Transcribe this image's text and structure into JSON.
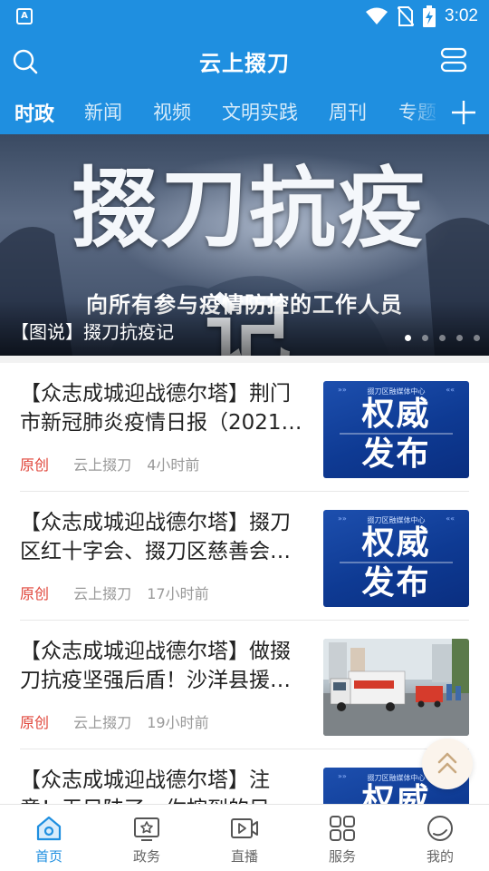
{
  "status_bar": {
    "time": "3:02",
    "app_icon_letter": "A"
  },
  "header": {
    "title": "云上掇刀",
    "search_icon": "search-icon",
    "menu_icon": "menu-icon"
  },
  "tabs": [
    {
      "label": "时政",
      "active": true
    },
    {
      "label": "新闻"
    },
    {
      "label": "视频"
    },
    {
      "label": "文明实践"
    },
    {
      "label": "周刊"
    },
    {
      "label": "专题"
    }
  ],
  "banner": {
    "headline": "掇刀抗疫记",
    "subtitle": "向所有参与疫情防控的工作人员",
    "caption": "【图说】掇刀抗疫记",
    "slide_count": 5,
    "active_slide": 0
  },
  "news": [
    {
      "title": "【众志成城迎战德尔塔】荆门市新冠肺炎疫情日报（2021…",
      "tag": "原创",
      "source": "云上掇刀",
      "time": "4小时前",
      "thumb": {
        "kind": "authority",
        "header": "掇刀区融媒体中心",
        "line1": "权威",
        "line2": "发布"
      }
    },
    {
      "title": "【众志成城迎战德尔塔】掇刀区红十字会、掇刀区慈善会…",
      "tag": "原创",
      "source": "云上掇刀",
      "time": "17小时前",
      "thumb": {
        "kind": "authority",
        "header": "掇刀区融媒体中心",
        "line1": "权威",
        "line2": "发布"
      }
    },
    {
      "title": "【众志成城迎战德尔塔】做掇刀抗疫坚强后盾！沙洋县援…",
      "tag": "原创",
      "source": "云上掇刀",
      "time": "19小时前",
      "thumb": {
        "kind": "photo"
      }
    },
    {
      "title": "【众志成城迎战德尔塔】注意！无目陕了，你按到的目…",
      "tag": "",
      "source": "",
      "time": "",
      "thumb": {
        "kind": "authority",
        "header": "掇刀区融媒体中心",
        "line1": "权威",
        "line2": ""
      }
    }
  ],
  "bottom_nav": [
    {
      "label": "首页",
      "icon": "home-icon",
      "active": true
    },
    {
      "label": "政务",
      "icon": "government-icon"
    },
    {
      "label": "直播",
      "icon": "live-video-icon"
    },
    {
      "label": "服务",
      "icon": "services-grid-icon"
    },
    {
      "label": "我的",
      "icon": "profile-icon"
    }
  ],
  "colors": {
    "brand": "#1f8fe0",
    "tag_red": "#e0453a",
    "meta_gray": "#999999"
  }
}
